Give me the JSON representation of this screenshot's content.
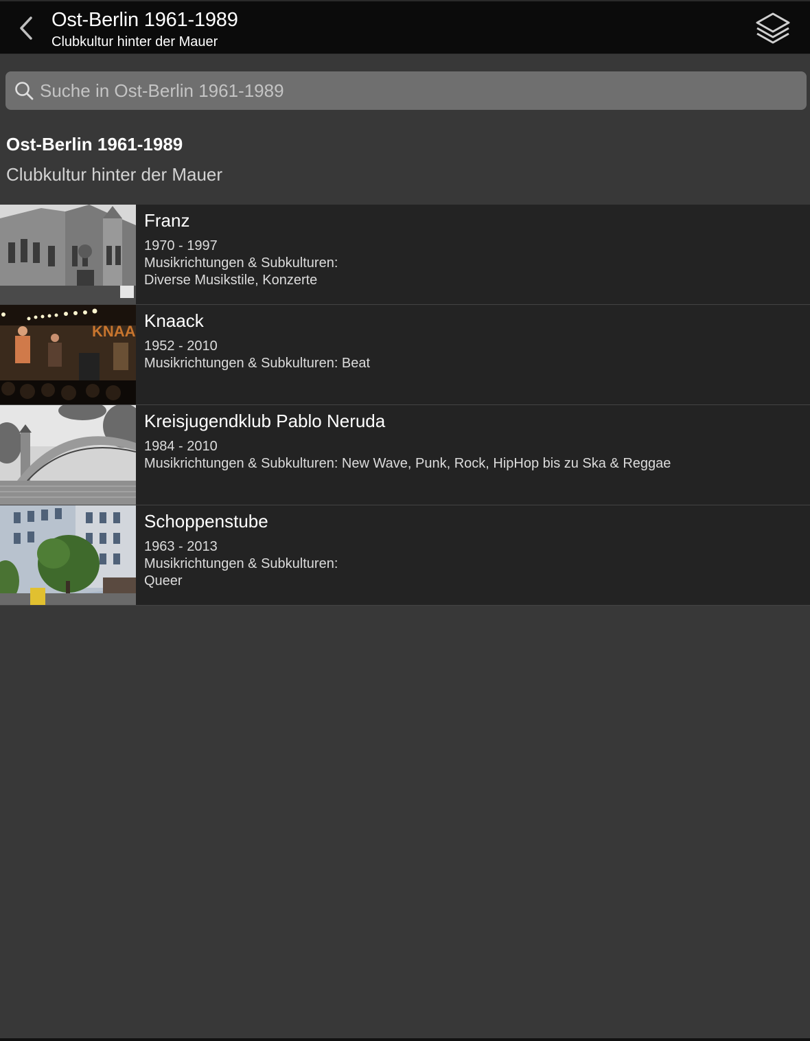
{
  "navbar": {
    "title": "Ost-Berlin 1961-1989",
    "subtitle": "Clubkultur hinter der Mauer",
    "back_icon": "chevron-left-icon",
    "layers_icon": "layers-icon"
  },
  "search": {
    "placeholder": "Suche in Ost-Berlin 1961-1989",
    "value": ""
  },
  "header": {
    "title": "Ost-Berlin 1961-1989",
    "subtitle": "Clubkultur hinter der Mauer"
  },
  "venues": [
    {
      "name": "Franz",
      "years": "1970 - 1997",
      "genres": "Musikrichtungen & Subkulturen:\nDiverse Musikstile, Konzerte"
    },
    {
      "name": "Knaack",
      "years": "1952 - 2010",
      "genres": "Musikrichtungen & Subkulturen: Beat",
      "thumb_text": "KNAACK"
    },
    {
      "name": "Kreisjugendklub Pablo Neruda",
      "years": "1984 - 2010",
      "genres": "Musikrichtungen & Subkulturen: New Wave, Punk, Rock, HipHop bis zu Ska & Reggae"
    },
    {
      "name": "Schoppenstube",
      "years": "1963 - 2013",
      "genres": "Musikrichtungen & Subkulturen:\nQueer"
    }
  ],
  "colors": {
    "background": "#383838",
    "navbar": "#0b0b0b",
    "list_row": "#232323",
    "search_field": "#6f6f6f"
  }
}
